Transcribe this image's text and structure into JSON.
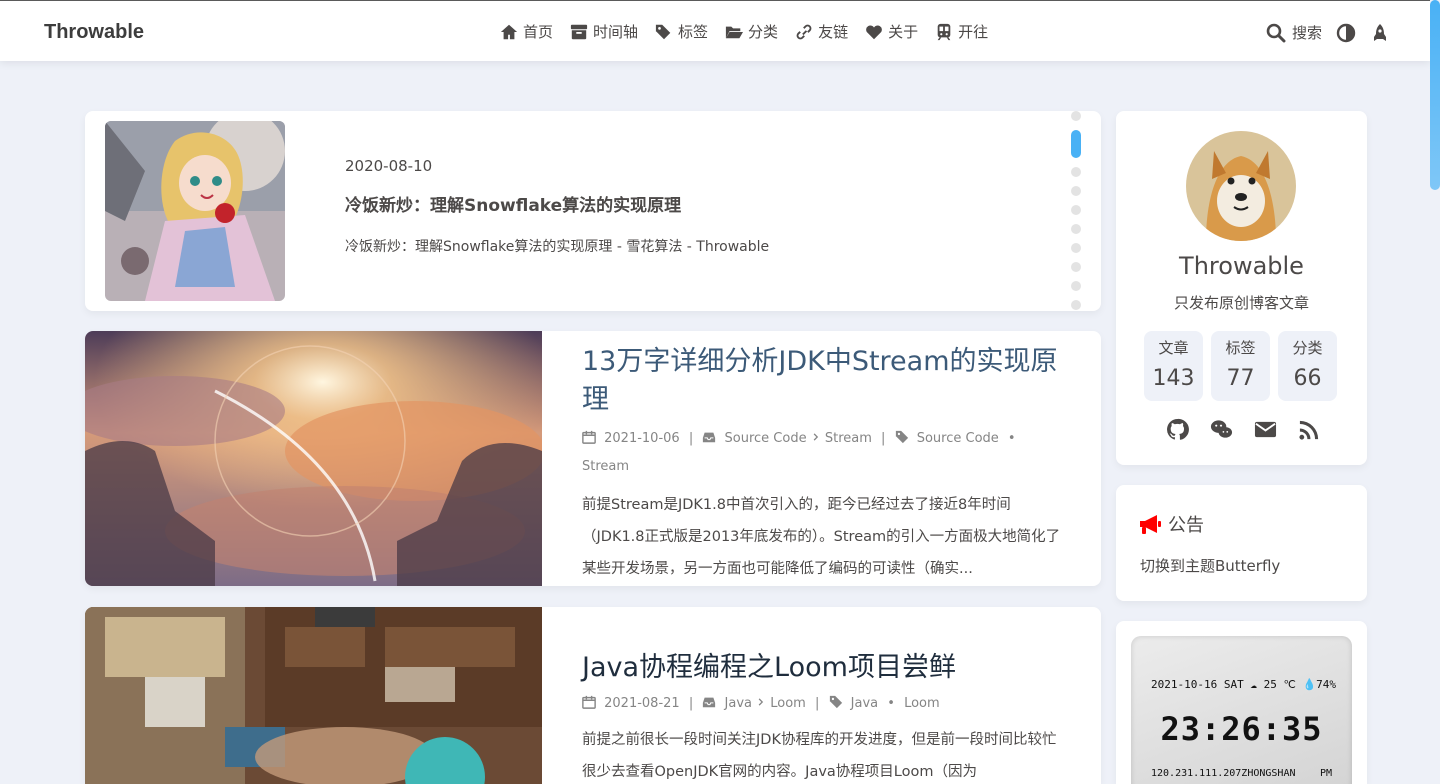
{
  "nav": {
    "brand": "Throwable",
    "menu": [
      {
        "label": "首页",
        "icon": "home-icon"
      },
      {
        "label": "时间轴",
        "icon": "archive-icon"
      },
      {
        "label": "标签",
        "icon": "tags-icon"
      },
      {
        "label": "分类",
        "icon": "folder-open-icon"
      },
      {
        "label": "友链",
        "icon": "link-icon"
      },
      {
        "label": "关于",
        "icon": "heart-icon"
      },
      {
        "label": "开往",
        "icon": "subway-icon"
      }
    ],
    "search_label": "搜索"
  },
  "swiper": {
    "date": "2020-08-10",
    "title": "冷饭新炒：理解Snowflake算法的实现原理",
    "description": "冷饭新炒：理解Snowflake算法的实现原理 - 雪花算法 - Throwable",
    "slide_count": 10,
    "active_index": 1
  },
  "posts": [
    {
      "title": "13万字详细分析JDK中Stream的实现原理",
      "date": "2021-10-06",
      "categories": [
        "Source Code",
        "Stream"
      ],
      "tags": [
        "Source Code",
        "Stream"
      ],
      "excerpt": "前提Stream是JDK1.8中首次引入的，距今已经过去了接近8年时间（JDK1.8正式版是2013年底发布的）。Stream的引入一方面极大地简化了某些开发场景，另一方面也可能降低了编码的可读性（确实..."
    },
    {
      "title": "Java协程编程之Loom项目尝鲜",
      "date": "2021-08-21",
      "categories": [
        "Java",
        "Loom"
      ],
      "tags": [
        "Java",
        "Loom"
      ],
      "excerpt": "前提之前很长一段时间关注JDK协程库的开发进度，但是前一段时间比较忙很少去查看OpenJDK官网的内容。Java协程项目Loom（因为"
    }
  ],
  "author": {
    "name": "Throwable",
    "description": "只发布原创博客文章",
    "stats": [
      {
        "label": "文章",
        "value": "143"
      },
      {
        "label": "标签",
        "value": "77"
      },
      {
        "label": "分类",
        "value": "66"
      }
    ],
    "socials": [
      "github-icon",
      "wechat-icon",
      "envelope-icon",
      "rss-icon"
    ]
  },
  "notice": {
    "title": "公告",
    "content": "切换到主题Butterfly"
  },
  "clock": {
    "date": "2021-10-16 SAT",
    "temperature": "25 ℃",
    "humidity": "74%",
    "time": "23:26:35",
    "ip_location": "120.231.111.207ZHONGSHAN",
    "ampm": "PM"
  },
  "colors": {
    "accent": "#49b1f5",
    "background": "#eef1f8",
    "notice_icon": "#ff0000"
  }
}
